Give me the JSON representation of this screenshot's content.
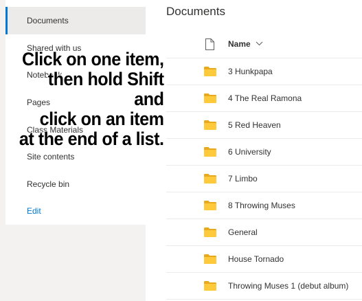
{
  "sidebar": {
    "items": [
      {
        "label": "Documents",
        "selected": true
      },
      {
        "label": "Shared with us"
      },
      {
        "label": "Notebook"
      },
      {
        "label": "Pages"
      },
      {
        "label": "Class Materials"
      },
      {
        "label": "Site contents"
      },
      {
        "label": "Recycle bin"
      }
    ],
    "edit_label": "Edit"
  },
  "main": {
    "title": "Documents",
    "columns": {
      "type_icon": "document-icon",
      "name": "Name",
      "sort_icon": "chevron-down-icon"
    },
    "rows": [
      {
        "name": "3 Hunkpapa",
        "icon": "folder-icon"
      },
      {
        "name": "4 The Real Ramona",
        "icon": "folder-icon"
      },
      {
        "name": "5 Red Heaven",
        "icon": "folder-icon"
      },
      {
        "name": "6 University",
        "icon": "folder-icon"
      },
      {
        "name": "7 Limbo",
        "icon": "folder-icon"
      },
      {
        "name": "8 Throwing Muses",
        "icon": "folder-icon"
      },
      {
        "name": "General",
        "icon": "folder-icon"
      },
      {
        "name": "House Tornado",
        "icon": "folder-icon"
      },
      {
        "name": "Throwing Muses 1 (debut album)",
        "icon": "folder-icon"
      }
    ]
  },
  "overlay": {
    "lines": [
      "Click on one item,",
      "then hold Shift",
      "and",
      "click on an item",
      "at the end of a list."
    ]
  },
  "colors": {
    "accent": "#0078d4",
    "folder": "#ffc93c",
    "text": "#323130",
    "page_background": "#f3f2f1"
  }
}
